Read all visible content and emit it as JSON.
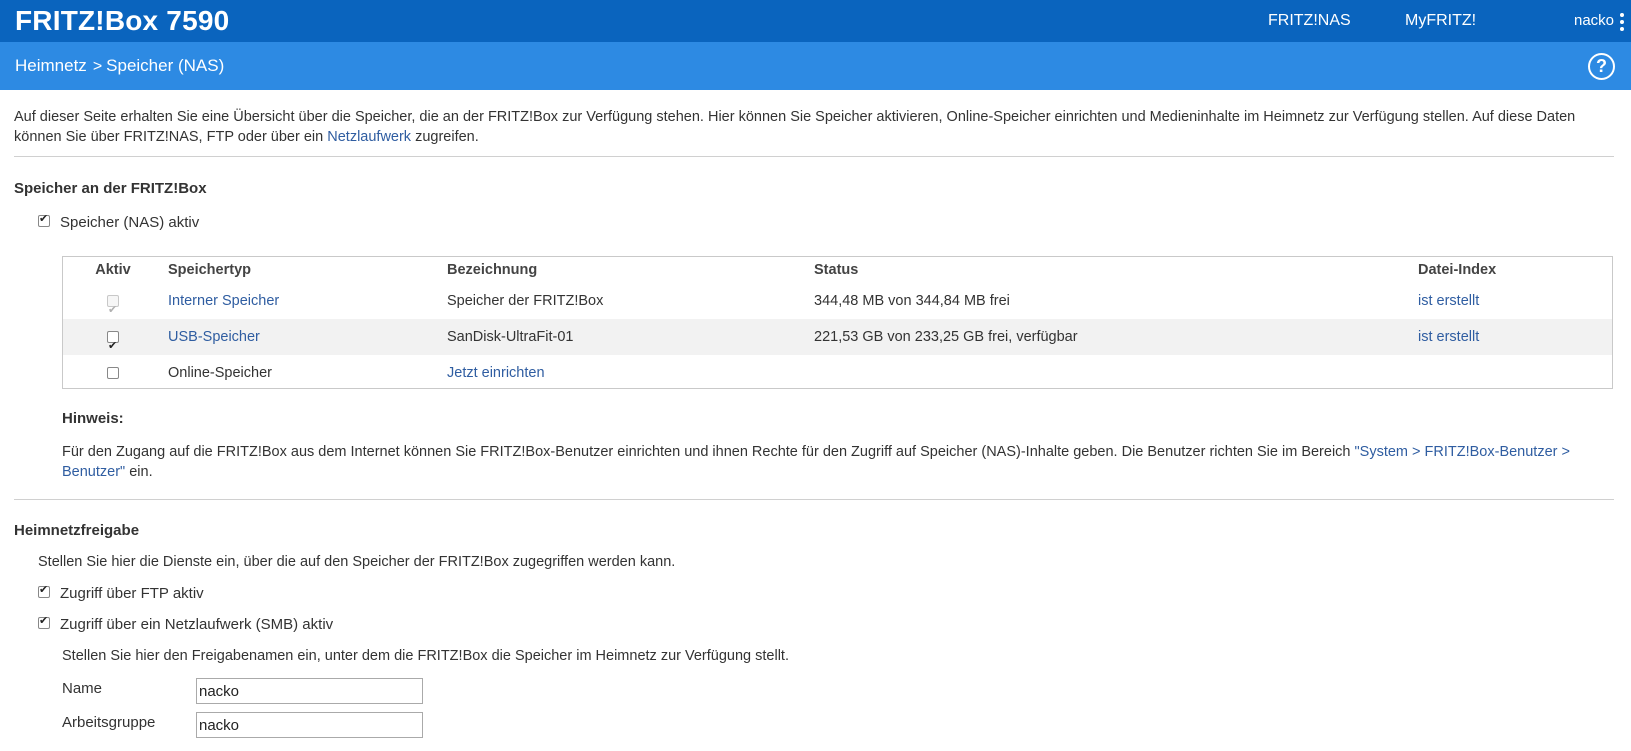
{
  "header": {
    "brand": "FRITZ!Box 7590",
    "nav": {
      "nas": "FRITZ!NAS",
      "myfritz": "MyFRITZ!",
      "user": "nacko"
    }
  },
  "breadcrumb": {
    "parent": "Heimnetz",
    "separator": ">",
    "current": "Speicher (NAS)",
    "help": "?"
  },
  "intro": {
    "text_before": "Auf dieser Seite erhalten Sie eine Übersicht über die Speicher, die an der FRITZ!Box zur Verfügung stehen. Hier können Sie Speicher aktivieren, Online-Speicher einrichten und Medieninhalte im Heimnetz zur Verfügung stellen. Auf diese Daten können Sie über FRITZ!NAS, FTP oder über ein",
    "link": "Netzlaufwerk",
    "text_after": "zugreifen."
  },
  "storage": {
    "section_title": "Speicher an der FRITZ!Box",
    "nas_active_label": "Speicher (NAS) aktiv",
    "nas_active_checked": true,
    "columns": [
      "Aktiv",
      "Speichertyp",
      "Bezeichnung",
      "Status",
      "Datei-Index"
    ],
    "rows": [
      {
        "active": true,
        "disabled": true,
        "type": "Interner Speicher",
        "type_link": true,
        "name": "Speicher der FRITZ!Box",
        "name_link": false,
        "status": "344,48 MB von 344,84 MB frei",
        "index": "ist erstellt"
      },
      {
        "active": true,
        "disabled": false,
        "type": "USB-Speicher",
        "type_link": true,
        "name": "SanDisk-UltraFit-01",
        "name_link": false,
        "status": "221,53 GB von 233,25 GB frei, verfügbar",
        "index": "ist erstellt"
      },
      {
        "active": false,
        "disabled": false,
        "type": "Online-Speicher",
        "type_link": false,
        "name": "Jetzt einrichten",
        "name_link": true,
        "status": "",
        "index": ""
      }
    ],
    "note_title": "Hinweis:",
    "note_text": "Für den Zugang auf die FRITZ!Box aus dem Internet können Sie FRITZ!Box-Benutzer einrichten und ihnen Rechte für den Zugriff auf Speicher (NAS)-Inhalte geben. Die Benutzer richten Sie im Bereich",
    "note_link": "\"System > FRITZ!Box-Benutzer > Benutzer\"",
    "note_after": "ein."
  },
  "share": {
    "section_title": "Heimnetzfreigabe",
    "description": "Stellen Sie hier die Dienste ein, über die auf den Speicher der FRITZ!Box zugegriffen werden kann.",
    "ftp_label": "Zugriff über FTP aktiv",
    "ftp_checked": true,
    "smb_label": "Zugriff über ein Netzlaufwerk (SMB) aktiv",
    "smb_checked": true,
    "smb_description": "Stellen Sie hier den Freigabenamen ein, unter dem die FRITZ!Box die Speicher im Heimnetz zur Verfügung stellt.",
    "name_label": "Name",
    "name_value": "nacko",
    "workgroup_label": "Arbeitsgruppe",
    "workgroup_value": "nacko"
  }
}
